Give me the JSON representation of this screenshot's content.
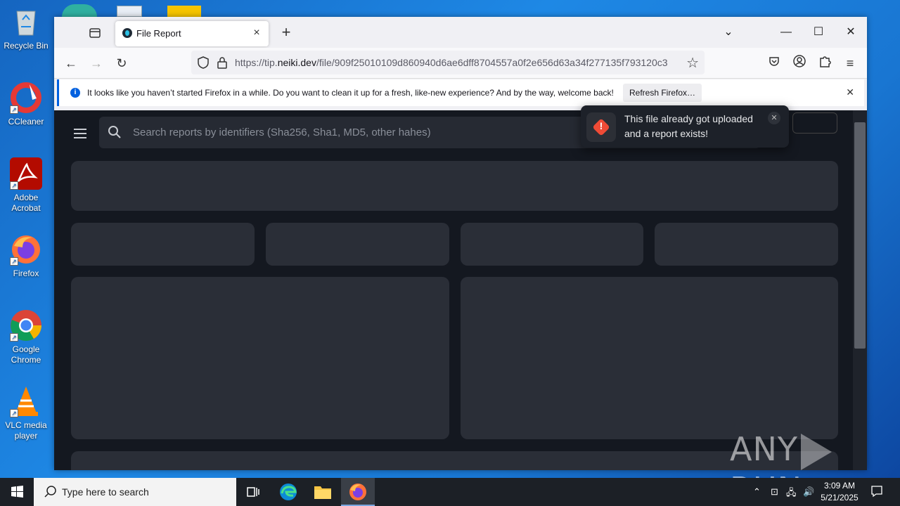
{
  "desktop": {
    "icons": [
      {
        "label": "Recycle Bin",
        "name": "recycle-bin-icon"
      },
      {
        "label": "CCleaner",
        "name": "ccleaner-icon"
      },
      {
        "label": "Adobe Acrobat",
        "name": "adobe-acrobat-icon"
      },
      {
        "label": "Firefox",
        "name": "firefox-icon"
      },
      {
        "label": "Google Chrome",
        "name": "google-chrome-icon"
      },
      {
        "label": "VLC media player",
        "name": "vlc-icon"
      }
    ]
  },
  "browser": {
    "tab": {
      "title": "File Report"
    },
    "url": {
      "prefix": "https://tip.",
      "domain": "neiki.dev",
      "path": "/file/909f25010109d860940d6ae6dff8704557a0f2e656d63a34f277135f793120c3"
    },
    "notification": {
      "message": "It looks like you haven’t started Firefox in a while. Do you want to clean it up for a fresh, like-new experience? And by the way, welcome back!",
      "button": "Refresh Firefox…"
    }
  },
  "page": {
    "search_placeholder": "Search reports by identifiers (Sha256, Sha1, MD5, other hahes)",
    "toast": {
      "message": "This file already got uploaded and a report exists!",
      "icon": "!"
    }
  },
  "watermark": {
    "left": "ANY",
    "right": "RUN"
  },
  "taskbar": {
    "search_placeholder": "Type here to search",
    "time": "3:09 AM",
    "date": "5/21/2025"
  },
  "colors": {
    "accent": "#0060df",
    "error": "#ef4b36",
    "page_bg": "#141820"
  }
}
